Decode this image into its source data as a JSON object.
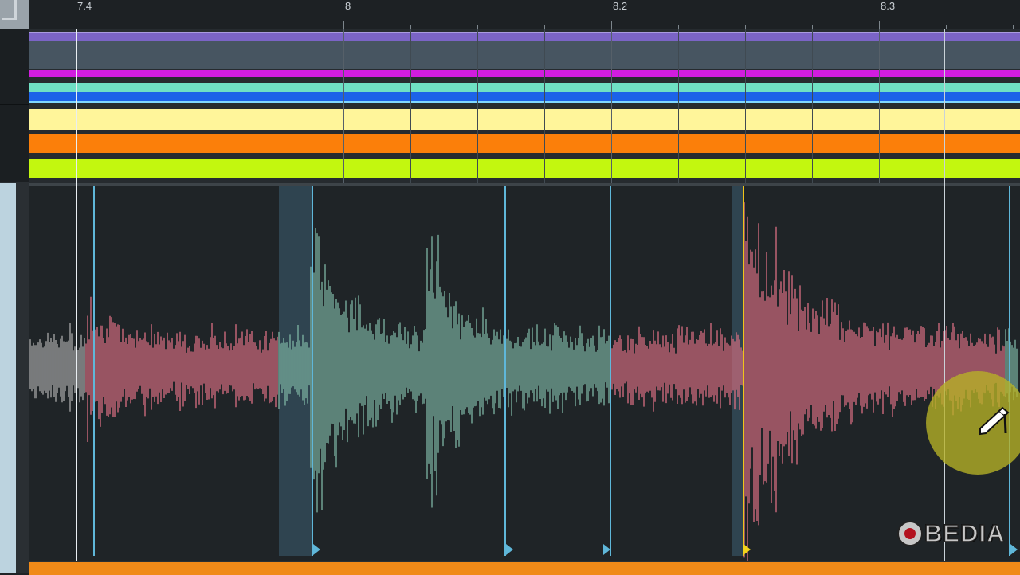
{
  "ruler": {
    "labels": [
      "7.4",
      "8",
      "8.2",
      "8.3"
    ]
  },
  "colors": {
    "lane_purple": "#7b64c6",
    "lane_magenta": "#d21de0",
    "lane_mint": "#6fe0c4",
    "lane_blue": "#1c62e8",
    "lane_yellow": "#fff59a",
    "lane_orange": "#fb7f0a",
    "lane_lime": "#c3f70f",
    "wave_pink": "#d96f82",
    "wave_green": "#7db5a3",
    "wave_grey": "#a9a9a9",
    "marker_blue": "#5fb7d9",
    "marker_yellow": "#f0c419"
  },
  "icons": {
    "cursor": "pencil-icon"
  },
  "watermark": {
    "text": "BEDIA"
  }
}
